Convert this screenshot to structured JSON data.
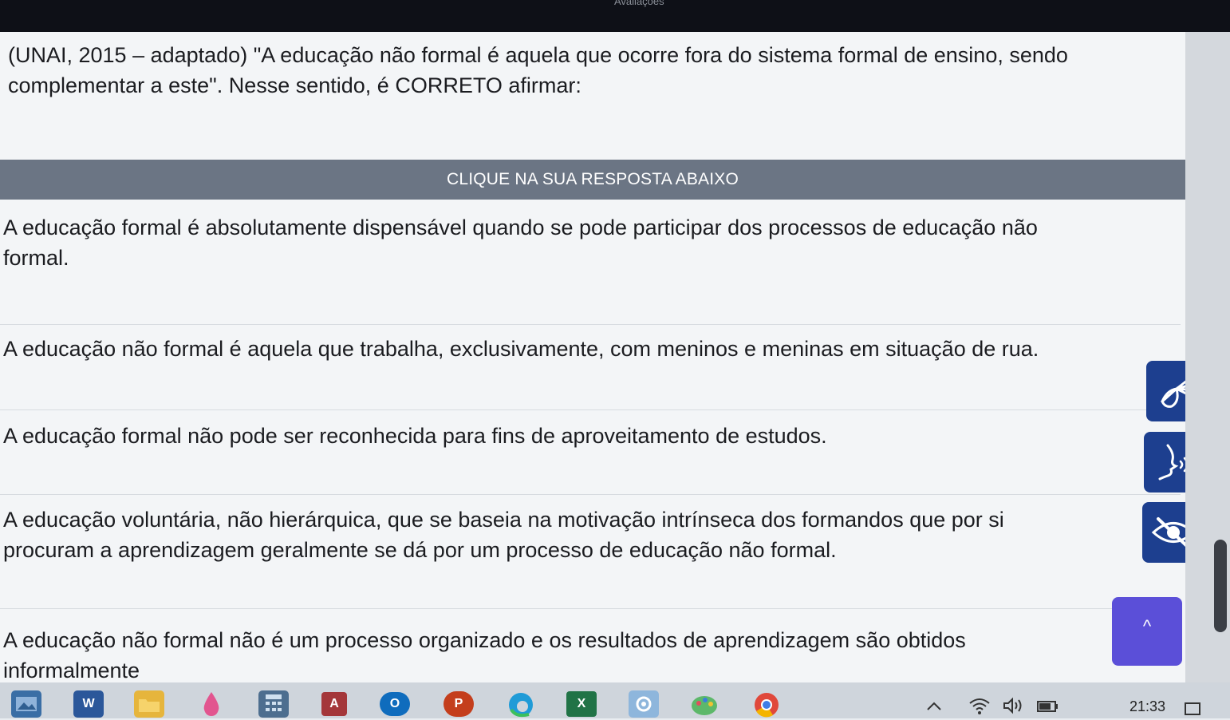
{
  "window": {
    "title": "Avaliações"
  },
  "question": {
    "text": "(UNAI, 2015 – adaptado) \"A educação não formal é aquela que ocorre fora do sistema formal de ensino, sendo complementar a este\". Nesse sentido, é CORRETO afirmar:"
  },
  "answers": {
    "header": "CLIQUE NA SUA RESPOSTA ABAIXO",
    "options": [
      {
        "text": "A educação formal é absolutamente dispensável quando se pode participar dos processos de educação não formal."
      },
      {
        "text": "A educação não formal é aquela que trabalha, exclusivamente, com meninos e meninas em situação de rua."
      },
      {
        "text": "A educação formal não pode ser reconhecida para fins de aproveitamento de estudos."
      },
      {
        "text": "A educação voluntária, não hierárquica, que se baseia na motivação intrínseca dos formandos que por si procuram a aprendizagem geralmente se dá por um processo de educação não formal."
      },
      {
        "text": "A educação não formal não é um processo organizado e os resultados de aprendizagem são obtidos informalmente"
      }
    ]
  },
  "accessibility": {
    "libras_icon": "sign-language-icon",
    "audio_icon": "audio-reader-icon",
    "contrast_icon": "hidden-eye-icon"
  },
  "scroll_top": {
    "icon": "^"
  },
  "taskbar": {
    "apps": [
      {
        "letter": "W",
        "color": "#2b579a"
      },
      {
        "letter": "A",
        "color": "#a4373a"
      },
      {
        "letter": "O",
        "color": "#0f6cbd"
      },
      {
        "letter": "P",
        "color": "#c43e1c"
      },
      {
        "letter": "X",
        "color": "#217346"
      }
    ],
    "clock": "21:33"
  },
  "colors": {
    "header_bg": "#6b7584",
    "a11y_btn": "#1d3f8f",
    "scroll_btn": "#5b4fd8"
  }
}
